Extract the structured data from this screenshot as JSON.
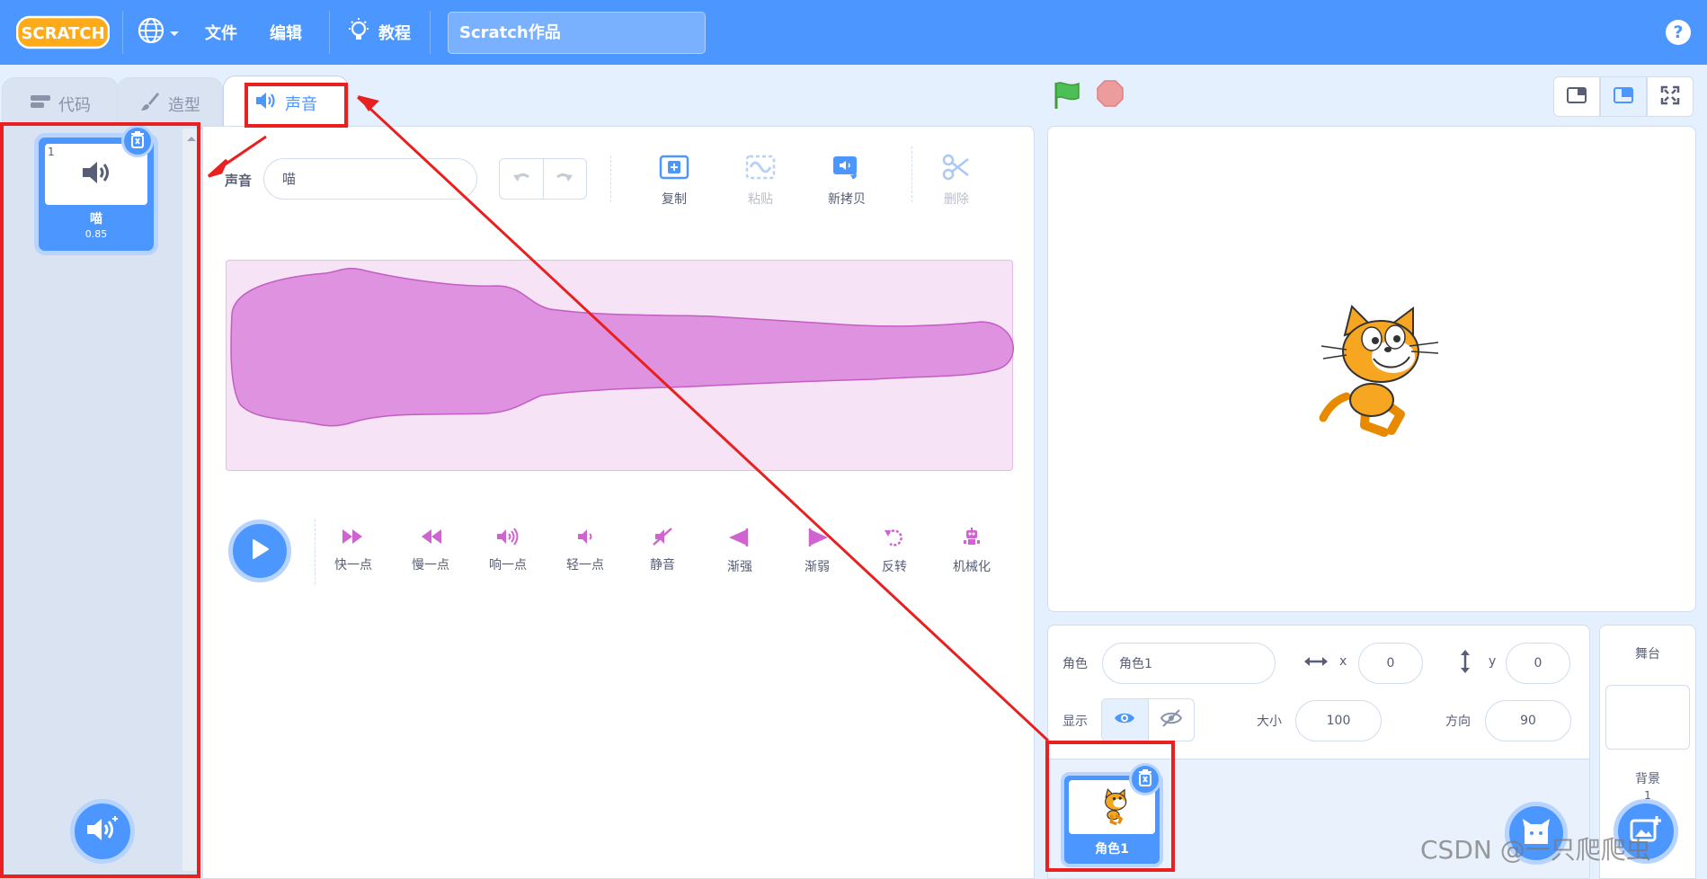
{
  "menubar": {
    "logo_text": "SCRATCH",
    "language_icon": "globe-icon",
    "file_label": "文件",
    "edit_label": "编辑",
    "tutorials_label": "教程",
    "project_title": "Scratch作品",
    "help_label": "?"
  },
  "tabs": [
    {
      "label": "代码",
      "icon": "code-icon",
      "active": false
    },
    {
      "label": "造型",
      "icon": "brush-icon",
      "active": false
    },
    {
      "label": "声音",
      "icon": "speaker-icon",
      "active": true
    }
  ],
  "sound_list": {
    "items": [
      {
        "index": "1",
        "name": "喵",
        "duration": "0.85",
        "icon": "speaker-icon"
      }
    ]
  },
  "editor": {
    "sound_label": "声音",
    "sound_name": "喵",
    "tools": [
      {
        "label": "复制",
        "icon": "copy-icon",
        "enabled": true
      },
      {
        "label": "粘贴",
        "icon": "paste-icon",
        "enabled": false
      },
      {
        "label": "新拷贝",
        "icon": "new-copy-icon",
        "enabled": true
      },
      {
        "label": "删除",
        "icon": "scissors-icon",
        "enabled": false
      }
    ],
    "effects": [
      {
        "label": "快一点",
        "icon": "faster-icon"
      },
      {
        "label": "慢一点",
        "icon": "slower-icon"
      },
      {
        "label": "响一点",
        "icon": "louder-icon"
      },
      {
        "label": "轻一点",
        "icon": "softer-icon"
      },
      {
        "label": "静音",
        "icon": "mute-icon"
      },
      {
        "label": "渐强",
        "icon": "fade-in-icon"
      },
      {
        "label": "渐弱",
        "icon": "fade-out-icon"
      },
      {
        "label": "反转",
        "icon": "reverse-icon"
      },
      {
        "label": "机械化",
        "icon": "robot-icon"
      }
    ]
  },
  "sprite_info": {
    "sprite_label": "角色",
    "sprite_name": "角色1",
    "x_label": "x",
    "x_value": "0",
    "y_label": "y",
    "y_value": "0",
    "show_label": "显示",
    "size_label": "大小",
    "size_value": "100",
    "direction_label": "方向",
    "direction_value": "90"
  },
  "sprites": [
    {
      "name": "角色1",
      "selected": true
    }
  ],
  "stage_panel": {
    "title": "舞台",
    "backdrops_label": "背景",
    "backdrop_count": "1"
  },
  "watermark": "CSDN @一只爬爬虫",
  "colors": {
    "menubar": "#4c97ff",
    "accent": "#4c97ff",
    "waveform_fill": "#df92df",
    "annotation": "#e8201f",
    "cat_orange": "#f7a622"
  }
}
